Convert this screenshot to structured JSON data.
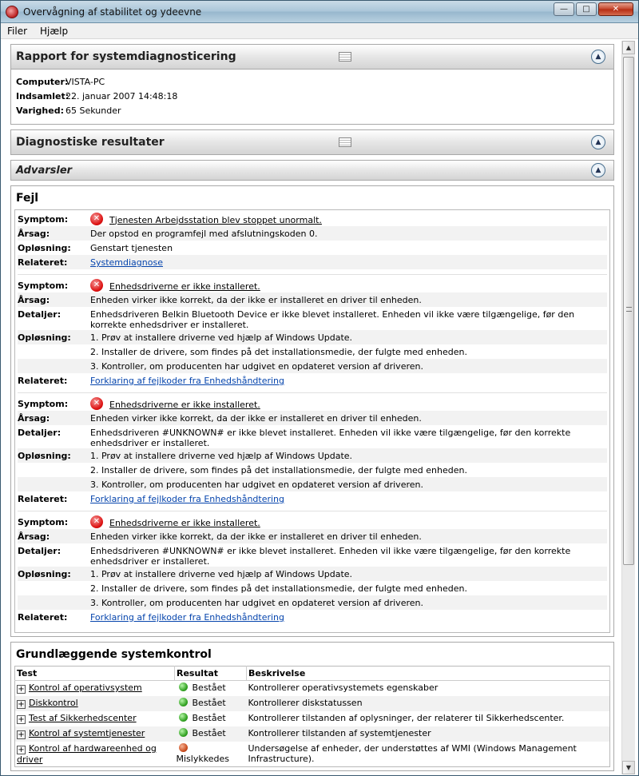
{
  "window": {
    "title": "Overvågning af stabilitet og ydeevne"
  },
  "menu": [
    "Filer",
    "Hjælp"
  ],
  "report": {
    "title": "Rapport for systemdiagnosticering",
    "rows": [
      {
        "label": "Computer:",
        "value": "VISTA-PC"
      },
      {
        "label": "Indsamlet:",
        "value": "22. januar 2007 14:48:18"
      },
      {
        "label": "Varighed:",
        "value": "65 Sekunder"
      }
    ]
  },
  "diagnostic": {
    "title": "Diagnostiske resultater"
  },
  "warnings": {
    "title": "Advarsler"
  },
  "errors": {
    "title": "Fejl",
    "labels": {
      "symptom": "Symptom:",
      "cause": "Årsag:",
      "details": "Detaljer:",
      "solution": "Opløsning:",
      "related": "Relateret:"
    },
    "items": [
      {
        "symptom": "Tjenesten Arbejdsstation blev stoppet unormalt.",
        "cause": "Der opstod en programfejl med afslutningskoden 0.",
        "solution": [
          "Genstart tjenesten"
        ],
        "related": "Systemdiagnose"
      },
      {
        "symptom": "Enhedsdriverne er ikke installeret.",
        "cause": "Enheden virker ikke korrekt, da der ikke er installeret en driver til enheden.",
        "details": "Enhedsdriveren Belkin Bluetooth Device er ikke blevet installeret. Enheden vil ikke være tilgængelige, før den korrekte enhedsdriver er installeret.",
        "solution": [
          "1. Prøv at installere driverne ved hjælp af Windows Update.",
          "2. Installer de drivere, som findes på det installationsmedie, der fulgte med enheden.",
          "3. Kontroller, om producenten har udgivet en opdateret version af driveren."
        ],
        "related": "Forklaring af fejlkoder fra Enhedshåndtering"
      },
      {
        "symptom": "Enhedsdriverne er ikke installeret.",
        "cause": "Enheden virker ikke korrekt, da der ikke er installeret en driver til enheden.",
        "details": "Enhedsdriveren #UNKNOWN# er ikke blevet installeret. Enheden vil ikke være tilgængelige, før den korrekte enhedsdriver er installeret.",
        "solution": [
          "1. Prøv at installere driverne ved hjælp af Windows Update.",
          "2. Installer de drivere, som findes på det installationsmedie, der fulgte med enheden.",
          "3. Kontroller, om producenten har udgivet en opdateret version af driveren."
        ],
        "related": "Forklaring af fejlkoder fra Enhedshåndtering"
      },
      {
        "symptom": "Enhedsdriverne er ikke installeret.",
        "cause": "Enheden virker ikke korrekt, da der ikke er installeret en driver til enheden.",
        "details": "Enhedsdriveren #UNKNOWN# er ikke blevet installeret. Enheden vil ikke være tilgængelige, før den korrekte enhedsdriver er installeret.",
        "solution": [
          "1. Prøv at installere driverne ved hjælp af Windows Update.",
          "2. Installer de drivere, som findes på det installationsmedie, der fulgte med enheden.",
          "3. Kontroller, om producenten har udgivet en opdateret version af driveren."
        ],
        "related": "Forklaring af fejlkoder fra Enhedshåndtering"
      }
    ]
  },
  "checks": {
    "title": "Grundlæggende systemkontrol",
    "headers": [
      "Test",
      "Resultat",
      "Beskrivelse"
    ],
    "rows": [
      {
        "test": "Kontrol af operativsystem",
        "result": "Bestået",
        "status": "pass",
        "desc": "Kontrollerer operativsystemets egenskaber"
      },
      {
        "test": "Diskkontrol",
        "result": "Bestået",
        "status": "pass",
        "desc": "Kontrollerer diskstatussen"
      },
      {
        "test": "Test af Sikkerhedscenter",
        "result": "Bestået",
        "status": "pass",
        "desc": "Kontrollerer tilstanden af oplysninger, der relaterer til Sikkerhedscenter."
      },
      {
        "test": "Kontrol af systemtjenester",
        "result": "Bestået",
        "status": "pass",
        "desc": "Kontrollerer tilstanden af systemtjenester"
      },
      {
        "test": "Kontrol af hardwareenhed og driver",
        "result": "Mislykkedes",
        "status": "fail",
        "desc": "Undersøgelse af enheder, der understøttes af WMI (Windows Management Infrastructure)."
      }
    ]
  },
  "colors": {
    "link": "#0645ad",
    "pass": "#2fa01f",
    "fail": "#c84a1c",
    "error": "#d11111"
  },
  "icons": {
    "app": "monitor-app-icon",
    "report": "report-icon",
    "collapse": "chevron-up-icon",
    "error": "error-x-icon",
    "expand": "plus-expander-icon"
  }
}
